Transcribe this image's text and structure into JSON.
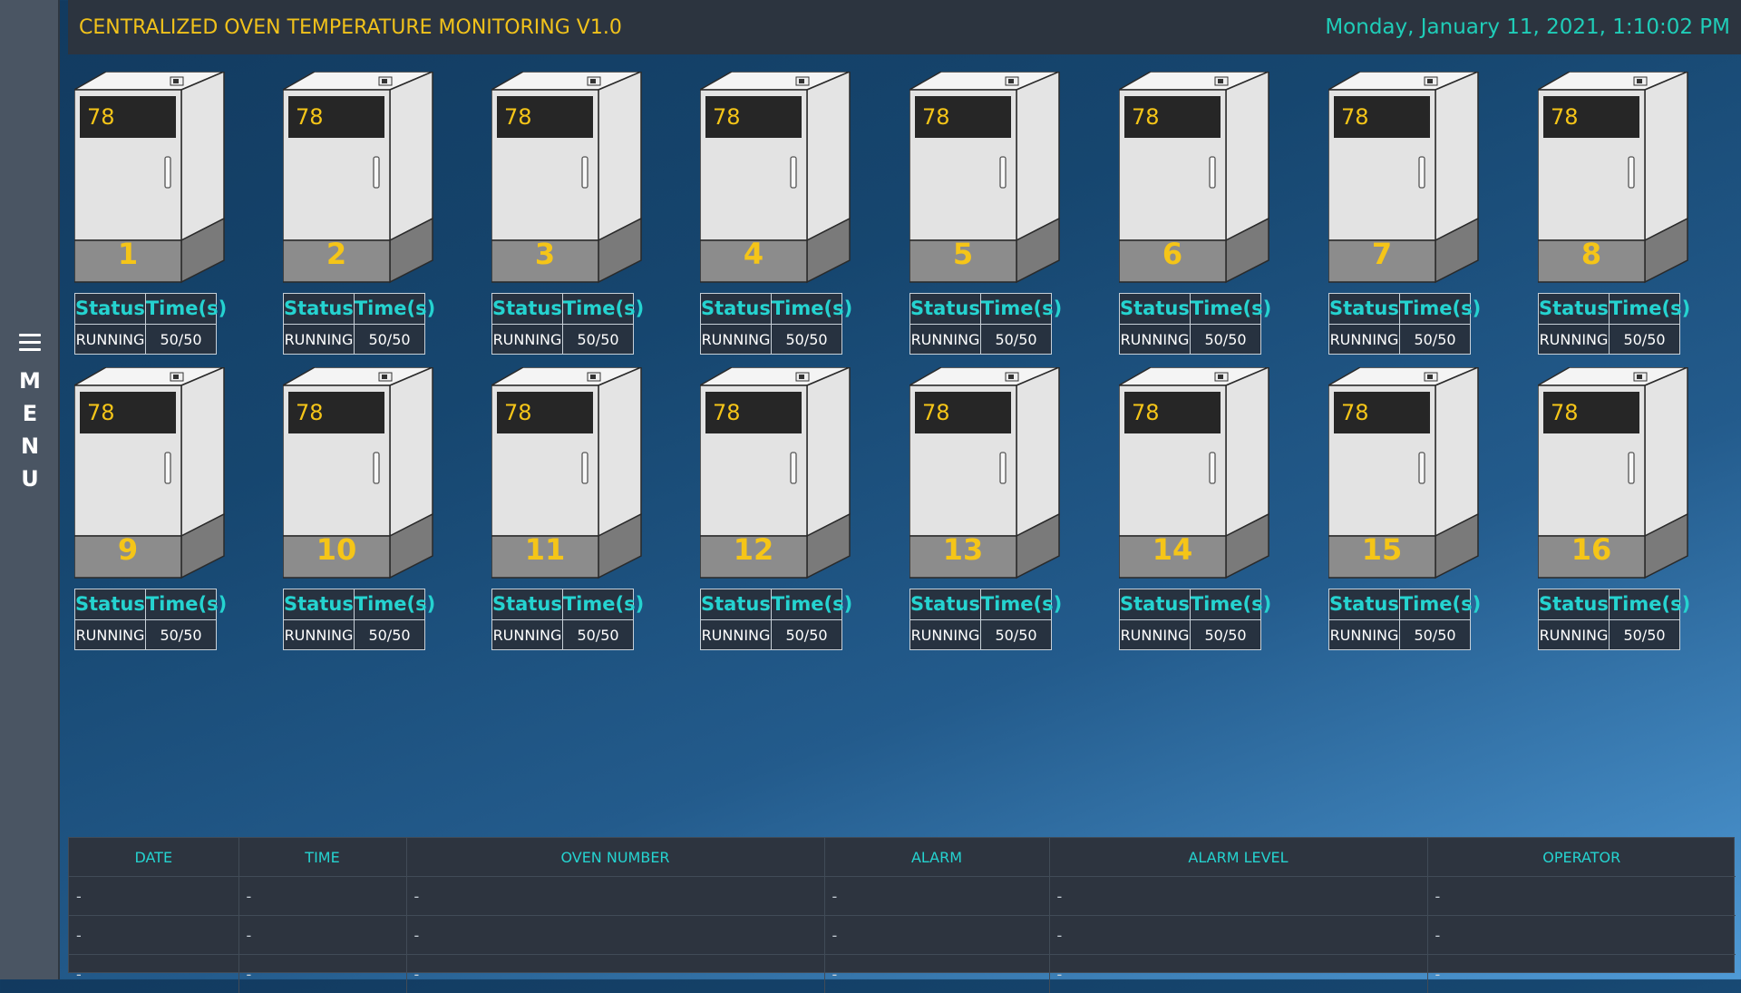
{
  "sidebar": {
    "menu_letters": [
      "M",
      "E",
      "N",
      "U"
    ]
  },
  "header": {
    "title": "CENTRALIZED OVEN TEMPERATURE MONITORING V1.0",
    "datetime": "Monday, January 11, 2021, 1:10:02 PM"
  },
  "oven_table_headers": {
    "status": "Status",
    "time": "Time(s)"
  },
  "ovens": [
    {
      "number": "1",
      "temperature": "78",
      "status": "RUNNING",
      "time": "50/50"
    },
    {
      "number": "2",
      "temperature": "78",
      "status": "RUNNING",
      "time": "50/50"
    },
    {
      "number": "3",
      "temperature": "78",
      "status": "RUNNING",
      "time": "50/50"
    },
    {
      "number": "4",
      "temperature": "78",
      "status": "RUNNING",
      "time": "50/50"
    },
    {
      "number": "5",
      "temperature": "78",
      "status": "RUNNING",
      "time": "50/50"
    },
    {
      "number": "6",
      "temperature": "78",
      "status": "RUNNING",
      "time": "50/50"
    },
    {
      "number": "7",
      "temperature": "78",
      "status": "RUNNING",
      "time": "50/50"
    },
    {
      "number": "8",
      "temperature": "78",
      "status": "RUNNING",
      "time": "50/50"
    },
    {
      "number": "9",
      "temperature": "78",
      "status": "RUNNING",
      "time": "50/50"
    },
    {
      "number": "10",
      "temperature": "78",
      "status": "RUNNING",
      "time": "50/50"
    },
    {
      "number": "11",
      "temperature": "78",
      "status": "RUNNING",
      "time": "50/50"
    },
    {
      "number": "12",
      "temperature": "78",
      "status": "RUNNING",
      "time": "50/50"
    },
    {
      "number": "13",
      "temperature": "78",
      "status": "RUNNING",
      "time": "50/50"
    },
    {
      "number": "14",
      "temperature": "78",
      "status": "RUNNING",
      "time": "50/50"
    },
    {
      "number": "15",
      "temperature": "78",
      "status": "RUNNING",
      "time": "50/50"
    },
    {
      "number": "16",
      "temperature": "78",
      "status": "RUNNING",
      "time": "50/50"
    }
  ],
  "alarm_table": {
    "columns": [
      "DATE",
      "TIME",
      "OVEN NUMBER",
      "ALARM",
      "ALARM LEVEL",
      "OPERATOR"
    ],
    "rows": [
      [
        "-",
        "-",
        "-",
        "-",
        "-",
        "-"
      ],
      [
        "-",
        "-",
        "-",
        "-",
        "-",
        "-"
      ],
      [
        "-",
        "-",
        "-",
        "-",
        "-",
        "-"
      ]
    ]
  },
  "colors": {
    "accent_yellow": "#f5c518",
    "accent_teal": "#25d3d0",
    "header_bg": "#2c343f",
    "sidebar_bg": "#4a5563"
  }
}
